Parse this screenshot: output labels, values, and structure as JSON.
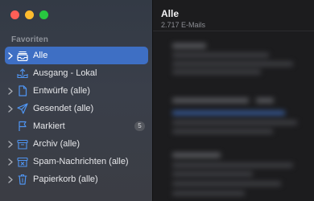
{
  "window": {
    "controls": [
      "close",
      "minimize",
      "zoom"
    ]
  },
  "sidebar": {
    "section_title": "Favoriten",
    "accent_color": "#3e6fc4",
    "items": [
      {
        "label": "Alle",
        "icon": "tray-stack-icon",
        "has_chevron": true,
        "selected": true
      },
      {
        "label": "Ausgang - Lokal",
        "icon": "outbox-tray-icon",
        "has_chevron": false,
        "selected": false
      },
      {
        "label": "Entwürfe (alle)",
        "icon": "document-icon",
        "has_chevron": true,
        "selected": false
      },
      {
        "label": "Gesendet (alle)",
        "icon": "paper-plane-icon",
        "has_chevron": true,
        "selected": false
      },
      {
        "label": "Markiert",
        "icon": "flag-icon",
        "has_chevron": false,
        "selected": false,
        "badge": "5"
      },
      {
        "label": "Archiv (alle)",
        "icon": "archive-box-icon",
        "has_chevron": true,
        "selected": false
      },
      {
        "label": "Spam-Nachrichten (alle)",
        "icon": "junk-box-icon",
        "has_chevron": true,
        "selected": false
      },
      {
        "label": "Papierkorb (alle)",
        "icon": "trash-icon",
        "has_chevron": true,
        "selected": false
      }
    ]
  },
  "mailbox": {
    "title": "Alle",
    "count": "2.717 E-Mails"
  }
}
